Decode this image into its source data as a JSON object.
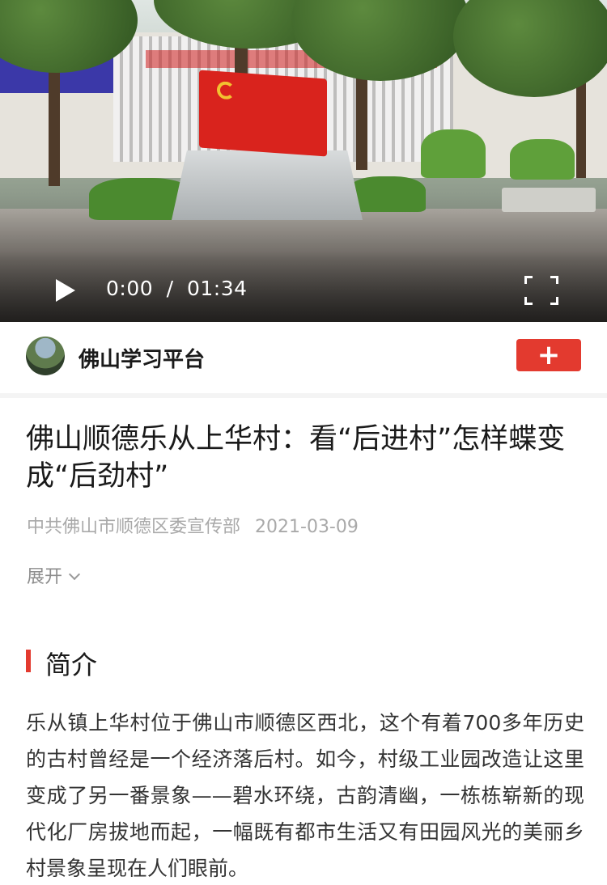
{
  "video": {
    "current_time": "0:00",
    "separator": "/",
    "duration": "01:34"
  },
  "channel": {
    "name": "佛山学习平台",
    "follow_label": "+"
  },
  "article": {
    "title": "佛山顺德乐从上华村：看“后进村”怎样蝶变成“后劲村”",
    "source": "中共佛山市顺德区委宣传部",
    "date": "2021-03-09",
    "expand_label": "展开"
  },
  "section": {
    "title": "简介",
    "body": "乐从镇上华村位于佛山市顺德区西北，这个有着700多年历史的古村曾经是一个经济落后村。如今，村级工业园改造让这里变成了另一番景象——碧水环绕，古韵清幽，一栋栋崭新的现代化厂房拔地而起，一幅既有都市生活又有田园风光的美丽乡村景象呈现在人们眼前。"
  },
  "colors": {
    "accent": "#e33a2f",
    "meta_gray": "#a9a9a9"
  }
}
